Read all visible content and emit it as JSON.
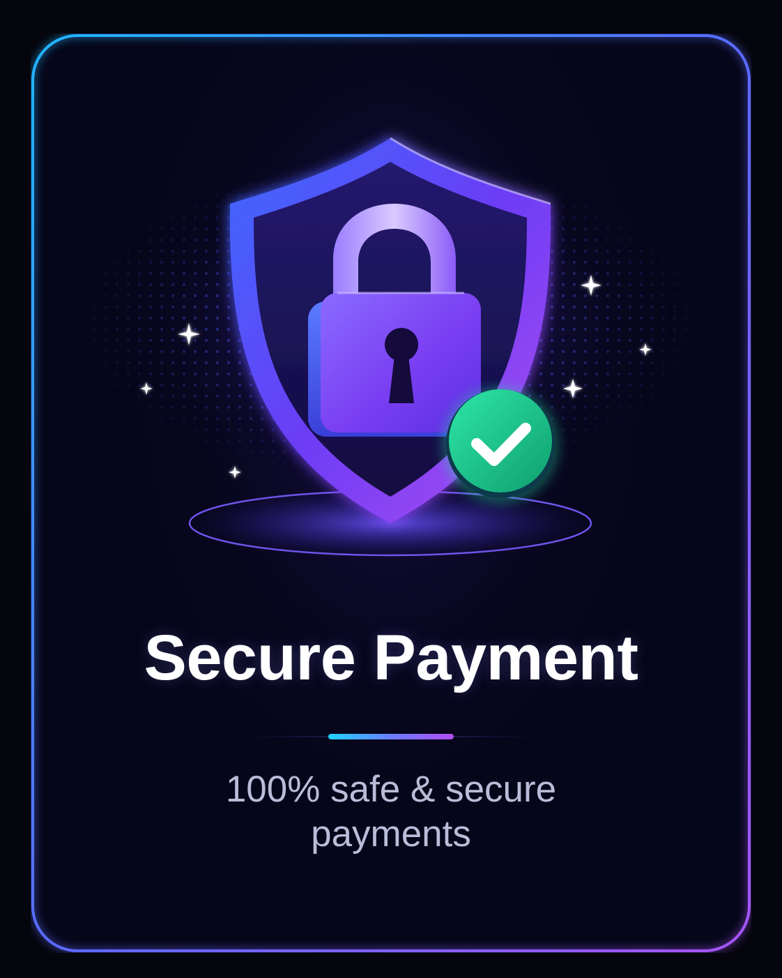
{
  "card": {
    "title": "Secure Payment",
    "subtitle": "100% safe & secure payments"
  },
  "hero": {
    "icons": [
      "shield-icon",
      "padlock-icon",
      "keyhole-icon",
      "checkmark-badge-icon",
      "sparkle-icon"
    ]
  },
  "colors": {
    "background": "#05050d",
    "card_fill": "#06061a",
    "border_start": "#1fb6ff",
    "border_end": "#a855f7",
    "shield": "#5b3df5",
    "lock": "#8b5cf6",
    "check_badge": "#14c98a",
    "title": "#ffffff",
    "subtitle": "#b9bdd8"
  }
}
